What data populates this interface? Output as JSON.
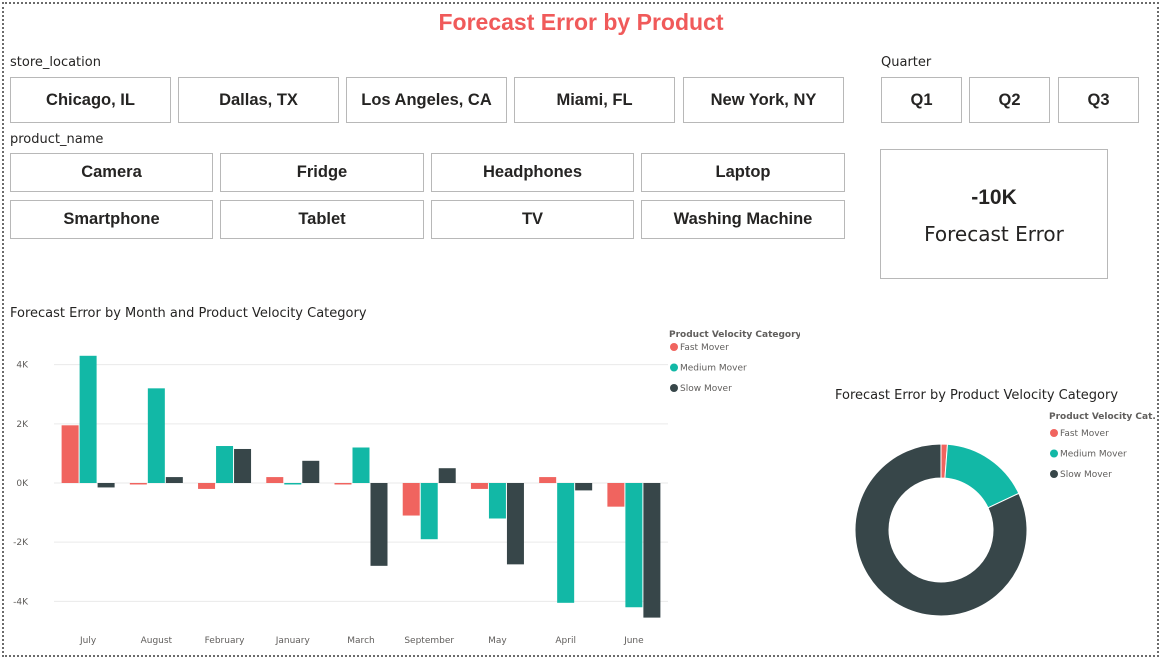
{
  "report": {
    "title": "Forecast Error by Product"
  },
  "store_slicer": {
    "label": "store_location",
    "options": [
      "Chicago, IL",
      "Dallas, TX",
      "Los Angeles, CA",
      "Miami, FL",
      "New York, NY"
    ]
  },
  "quarter_slicer": {
    "label": "Quarter",
    "options": [
      "Q1",
      "Q2",
      "Q3"
    ]
  },
  "product_slicer": {
    "label": "product_name",
    "options": [
      "Camera",
      "Fridge",
      "Headphones",
      "Laptop",
      "Smartphone",
      "Tablet",
      "TV",
      "Washing Machine"
    ]
  },
  "kpi_card": {
    "value": "-10K",
    "label": "Forecast Error"
  },
  "colors": {
    "fast_mover": "#f0645f",
    "medium_mover": "#12b8a6",
    "slow_mover": "#374649",
    "title": "#f05a5a"
  },
  "chart_data": [
    {
      "type": "bar",
      "title": "Forecast Error by Month and Product Velocity Category",
      "legend_title": "Product Velocity Category",
      "legend_position": "top-right",
      "categories": [
        "July",
        "August",
        "February",
        "January",
        "March",
        "September",
        "May",
        "April",
        "June"
      ],
      "series": [
        {
          "name": "Fast Mover",
          "values": [
            1950,
            -50,
            -200,
            200,
            -50,
            -1100,
            -200,
            200,
            -800
          ]
        },
        {
          "name": "Medium Mover",
          "values": [
            4300,
            3200,
            1250,
            -50,
            1200,
            -1900,
            -1200,
            -4050,
            -4200
          ]
        },
        {
          "name": "Slow Mover",
          "values": [
            -150,
            200,
            1150,
            750,
            -2800,
            500,
            -2750,
            -250,
            -4550
          ]
        }
      ],
      "y_ticks": [
        "-4K",
        "-2K",
        "0K",
        "2K",
        "4K"
      ],
      "y_tick_values": [
        -4000,
        -2000,
        0,
        2000,
        4000
      ],
      "ylim": [
        -4800,
        4800
      ],
      "grid": true
    },
    {
      "type": "pie",
      "title": "Forecast Error by Product Velocity Category",
      "legend_title": "Product Velocity Cat...",
      "legend_position": "top-right",
      "labels": [
        "Fast Mover",
        "Medium Mover",
        "Slow Mover"
      ],
      "values": [
        1.2,
        16.8,
        82.0
      ],
      "donut": true
    }
  ]
}
